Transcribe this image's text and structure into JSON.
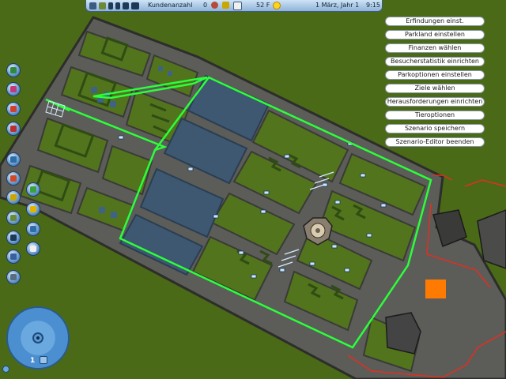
{
  "topbar": {
    "guests_label": "Kundenanzahl",
    "guests_count": "0",
    "temperature": "52 F",
    "date": "1 März, Jahr 1",
    "time": "9:15"
  },
  "menu": {
    "items": [
      "Erfindungen einst.",
      "Parkland einstellen",
      "Finanzen wählen",
      "Besucherstatistik einrichten",
      "Parkoptionen einstellen",
      "Ziele wählen",
      "Herausforderungen einrichten",
      "Tieroptionen",
      "Szenario speichern",
      "Szenario-Editor beenden"
    ]
  },
  "toolbar": {
    "icons": [
      "map-icon",
      "paths-icon",
      "rides-icon",
      "scenery-icon",
      "park-info-icon",
      "animals-icon",
      "staff-icon",
      "landscape-icon",
      "water-icon",
      "terrain-icon",
      "shop-icon",
      "inspect-icon",
      "demolish-icon"
    ]
  },
  "navigation": {
    "zoom_level": "1"
  },
  "colors": {
    "grass": "#4a6a18",
    "path": "#6c6c6c",
    "water": "#3d5870",
    "selection": "#2bff3a",
    "boundary": "#e03020",
    "marker": "#ff7a00",
    "ui_accent": "#4f86c2"
  }
}
